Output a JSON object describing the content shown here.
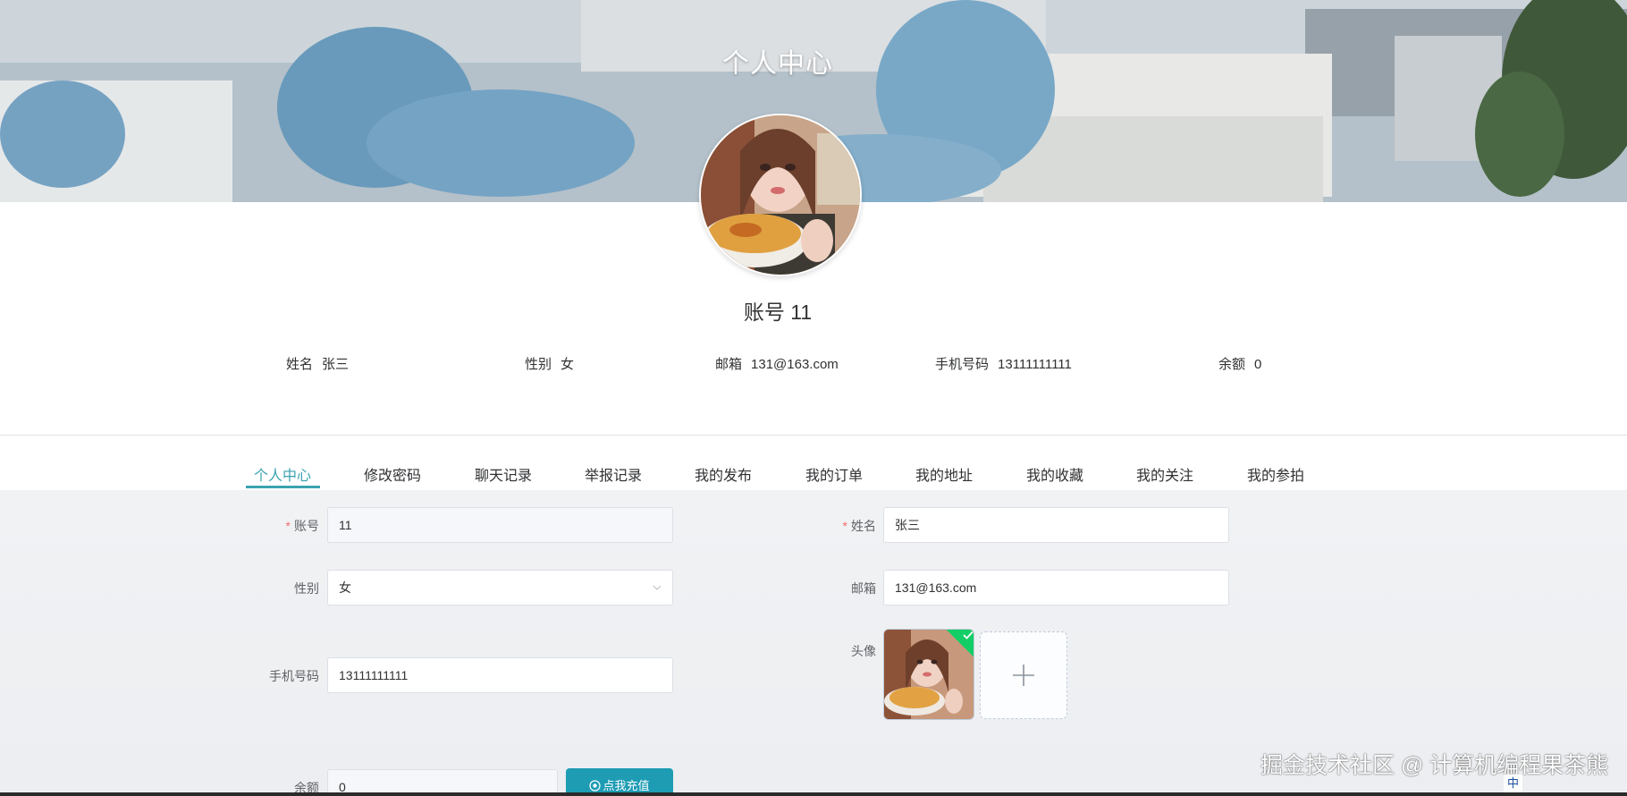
{
  "banner": {
    "title": "个人中心"
  },
  "profile": {
    "account_title": "账号 11",
    "info": [
      {
        "label": "姓名",
        "value": "张三"
      },
      {
        "label": "性别",
        "value": "女"
      },
      {
        "label": "邮箱",
        "value": "131@163.com"
      },
      {
        "label": "手机号码",
        "value": "13111111111"
      },
      {
        "label": "余额",
        "value": "0"
      }
    ]
  },
  "tabs": [
    {
      "label": "个人中心",
      "active": true
    },
    {
      "label": "修改密码",
      "active": false
    },
    {
      "label": "聊天记录",
      "active": false
    },
    {
      "label": "举报记录",
      "active": false
    },
    {
      "label": "我的发布",
      "active": false
    },
    {
      "label": "我的订单",
      "active": false
    },
    {
      "label": "我的地址",
      "active": false
    },
    {
      "label": "我的收藏",
      "active": false
    },
    {
      "label": "我的关注",
      "active": false
    },
    {
      "label": "我的参拍",
      "active": false
    }
  ],
  "form": {
    "account": {
      "label": "账号",
      "value": "11",
      "required": true
    },
    "name": {
      "label": "姓名",
      "value": "张三",
      "required": true
    },
    "gender": {
      "label": "性别",
      "value": "女"
    },
    "email": {
      "label": "邮箱",
      "value": "131@163.com"
    },
    "avatar": {
      "label": "头像"
    },
    "phone": {
      "label": "手机号码",
      "value": "13111111111"
    },
    "balance": {
      "label": "余额",
      "value": "0"
    },
    "recharge_label": "点我充值"
  },
  "watermark": "掘金技术社区 @ 计算机编程果茶熊",
  "taskbar": {
    "ime": "中"
  },
  "colors": {
    "accent": "#3aa3b1",
    "button": "#1e9cb4",
    "success": "#13ce66",
    "required": "#f56c6c"
  },
  "icons": {
    "select_arrow": "chevron-down-icon",
    "upload_success": "check-icon",
    "upload_add": "plus-icon",
    "recharge": "circle-dot-icon"
  }
}
